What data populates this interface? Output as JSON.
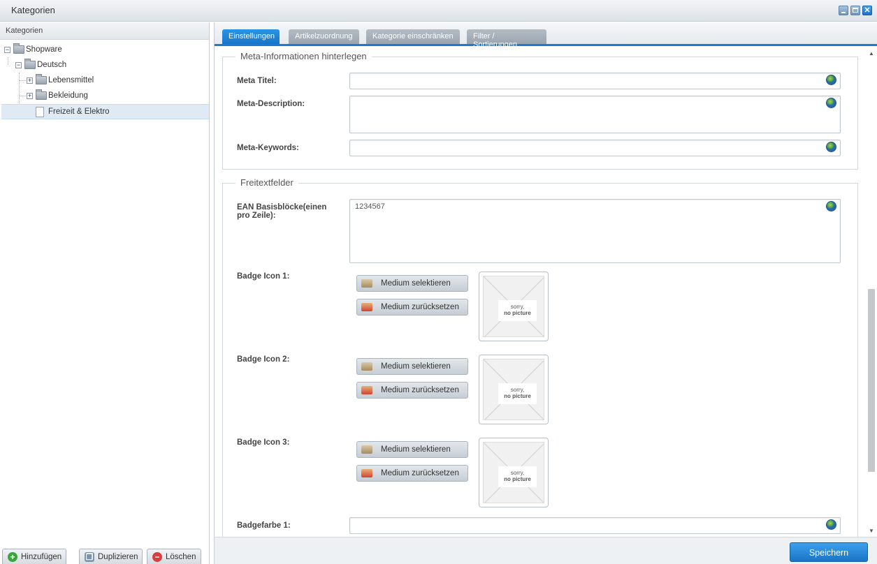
{
  "window": {
    "title": "Kategorien"
  },
  "left_panel": {
    "title": "Kategorien",
    "tree": [
      {
        "label": "Shopware",
        "expander": "−"
      },
      {
        "label": "Deutsch",
        "expander": "−"
      },
      {
        "label": "Lebensmittel",
        "expander": "+"
      },
      {
        "label": "Bekleidung",
        "expander": "+"
      },
      {
        "label": "Freizeit & Elektro",
        "expander": ""
      }
    ],
    "buttons": {
      "add": "Hinzufügen",
      "duplicate": "Duplizieren",
      "delete": "Löschen"
    }
  },
  "tabs": [
    {
      "label": "Einstellungen"
    },
    {
      "label": "Artikelzuordnung"
    },
    {
      "label": "Kategorie einschränken"
    },
    {
      "label": "Filter / Sortierungen"
    }
  ],
  "meta_section": {
    "legend": "Meta-Informationen hinterlegen",
    "meta_title_label": "Meta Titel:",
    "meta_title_value": "",
    "meta_description_label": "Meta-Description:",
    "meta_description_value": "",
    "meta_keywords_label": "Meta-Keywords:",
    "meta_keywords_value": ""
  },
  "freetext_section": {
    "legend": "Freitextfelder",
    "ean_label": "EAN Basisblöcke(einen pro Zeile):",
    "ean_value": "1234567",
    "badges": [
      {
        "label": "Badge Icon 1:"
      },
      {
        "label": "Badge Icon 2:"
      },
      {
        "label": "Badge Icon 3:"
      }
    ],
    "select_media": "Medium selektieren",
    "reset_media": "Medium zurücksetzen",
    "no_picture_line1": "sorry,",
    "no_picture_line2": "no picture",
    "badge_color_label": "Badgefarbe 1:",
    "badge_color_value": ""
  },
  "save_button": "Speichern",
  "colors": {
    "accent": "#1a74c6",
    "tab_inactive": "#a5afb9"
  }
}
